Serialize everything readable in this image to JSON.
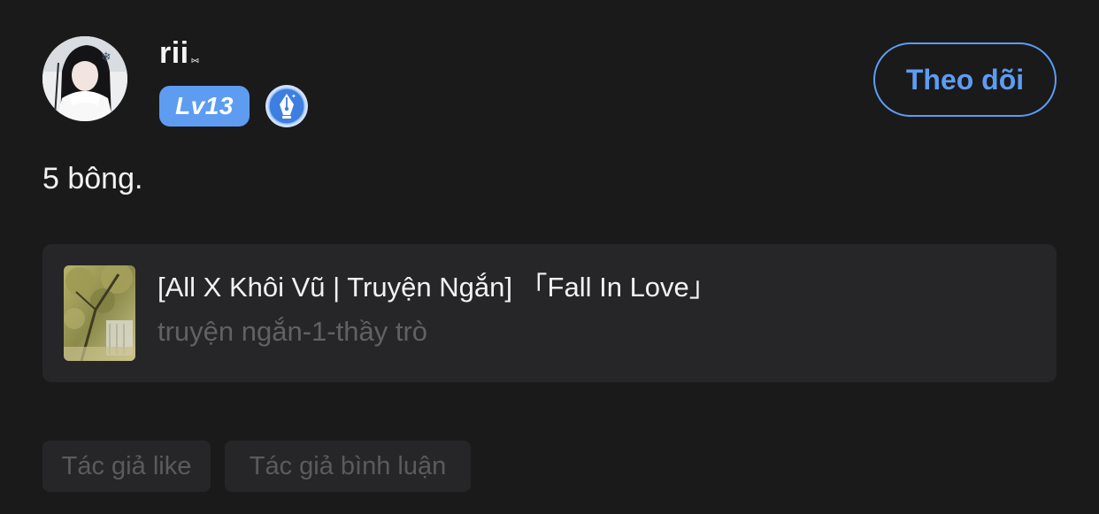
{
  "user": {
    "name": "rii",
    "name_suffix": "⑅",
    "level": "Lv13",
    "writer_badge_icon": "fountain-pen-icon"
  },
  "follow_button": {
    "label": "Theo dõi"
  },
  "post": {
    "text": "5 bông."
  },
  "story_card": {
    "title": "[All X Khôi Vũ | Truyện Ngắn] 「Fall In Love」",
    "tags": "truyện ngắn-1-thầy trò"
  },
  "chips": {
    "author_like": "Tác giả like",
    "author_comment": "Tác giả bình luận"
  },
  "colors": {
    "background": "#1a1a1b",
    "accent": "#5e9cf2",
    "card": "#262628",
    "muted_text": "#616164"
  }
}
